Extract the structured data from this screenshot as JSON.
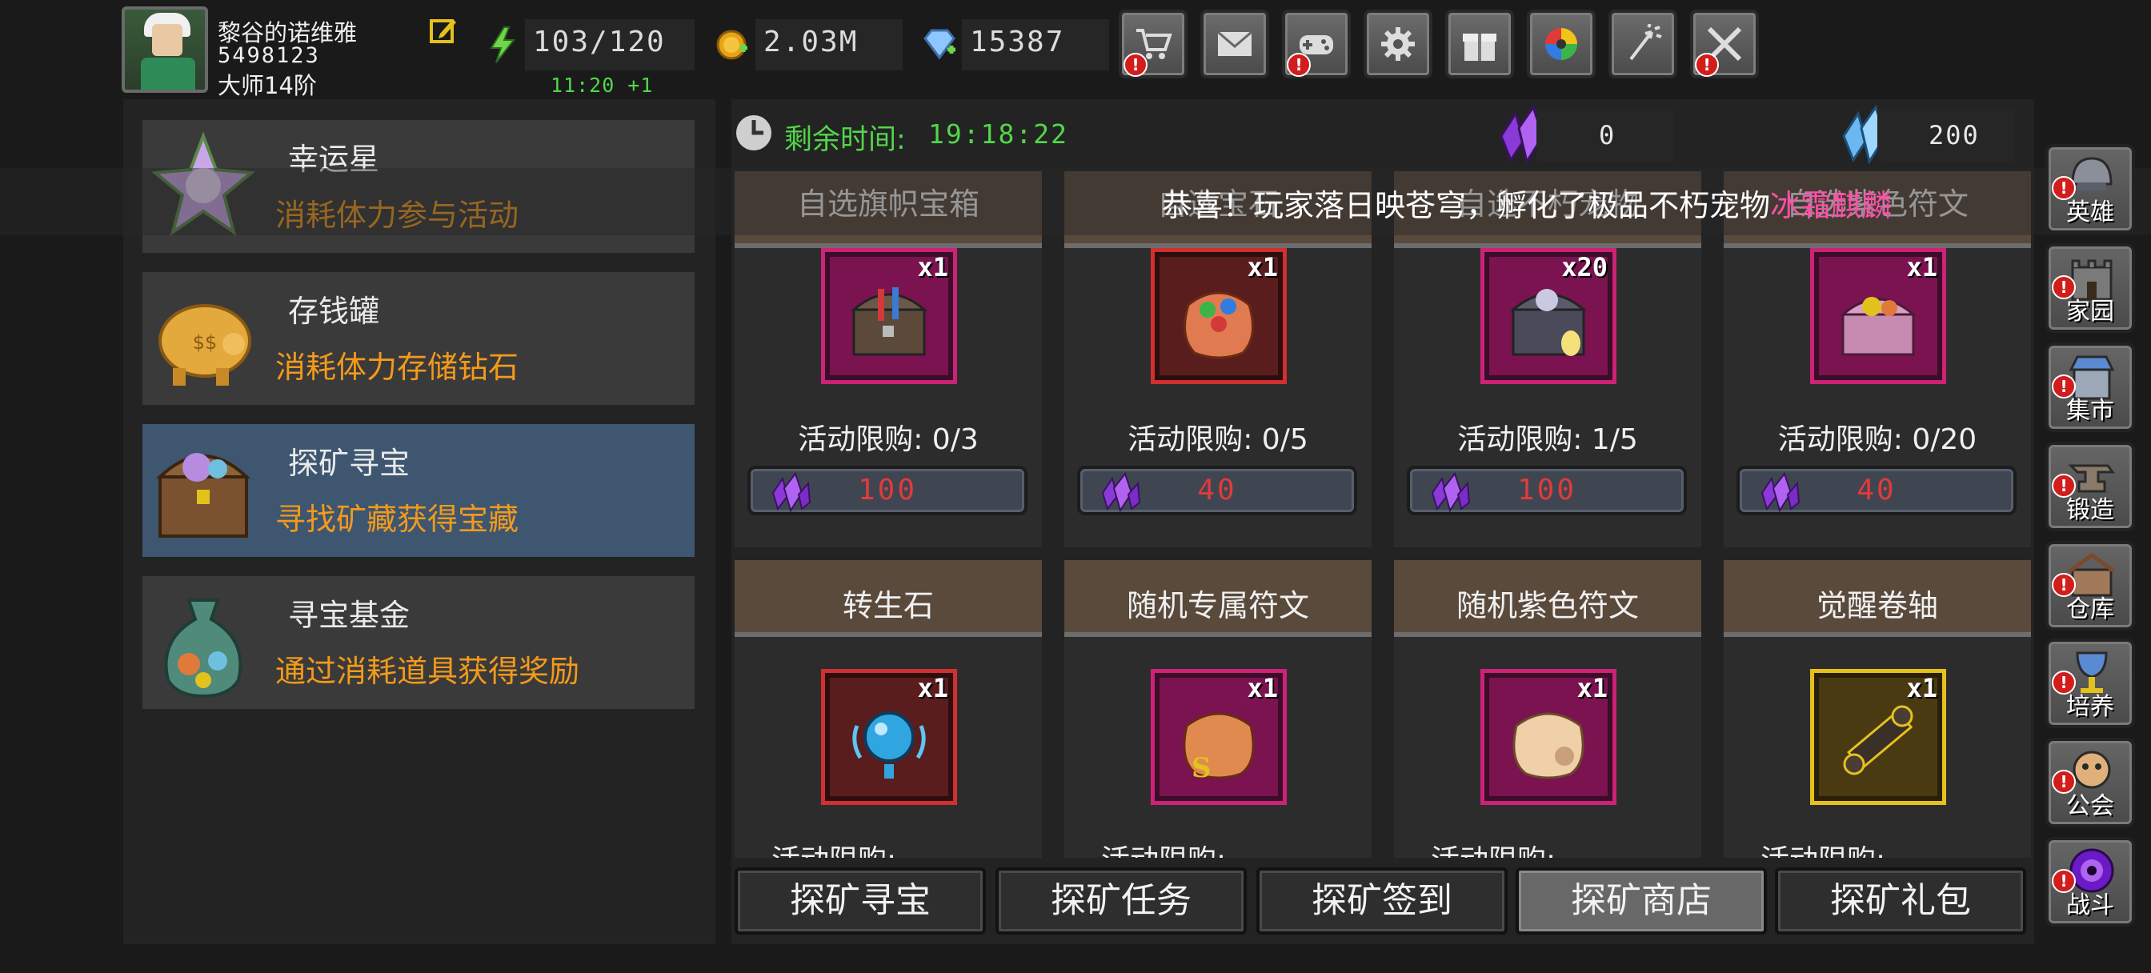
{
  "player": {
    "name": "黎谷的诺维雅",
    "id": "5498123",
    "rank": "大师14阶"
  },
  "resources": {
    "stamina": "103/120",
    "stamina_regen": "11:20 +1",
    "gold": "2.03M",
    "diamonds": "15387"
  },
  "top_buttons": [
    {
      "icon": "shop-cart-icon",
      "alert": true
    },
    {
      "icon": "mail-icon",
      "alert": false
    },
    {
      "icon": "gamepad-icon",
      "alert": true
    },
    {
      "icon": "settings-icon",
      "alert": false
    },
    {
      "icon": "gift-icon",
      "alert": false
    },
    {
      "icon": "color-wheel-icon",
      "alert": false
    },
    {
      "icon": "fireworks-icon",
      "alert": false
    },
    {
      "icon": "crossed-swords-icon",
      "alert": true
    }
  ],
  "menu": [
    {
      "title": "幸运星",
      "desc": "消耗体力参与活动"
    },
    {
      "title": "存钱罐",
      "desc": "消耗体力存储钻石"
    },
    {
      "title": "探矿寻宝",
      "desc": "寻找矿藏获得宝藏"
    },
    {
      "title": "寻宝基金",
      "desc": "通过消耗道具获得奖励"
    }
  ],
  "timer": {
    "label": "剩余时间:",
    "value": "19:18:22"
  },
  "currency": {
    "purple_crystal": "0",
    "blue_crystal": "200"
  },
  "broadcast": {
    "text": "恭喜！玩家落日映苍穹，孵化了极品不朽宠物",
    "highlight": "冰霜麒麟"
  },
  "shop_row1": [
    {
      "title": "自选旗帜宝箱",
      "qty": "x1",
      "limit": "活动限购: 0/3",
      "price": "100"
    },
    {
      "title": "自选宝石",
      "qty": "x1",
      "limit": "活动限购: 0/5",
      "price": "40"
    },
    {
      "title": "自选不朽宠物",
      "qty": "x20",
      "limit": "活动限购: 1/5",
      "price": "100"
    },
    {
      "title": "自选紫色符文",
      "qty": "x1",
      "limit": "活动限购: 0/20",
      "price": "40"
    }
  ],
  "shop_row2": [
    {
      "title": "转生石",
      "qty": "x1"
    },
    {
      "title": "随机专属符文",
      "qty": "x1"
    },
    {
      "title": "随机紫色符文",
      "qty": "x1"
    },
    {
      "title": "觉醒卷轴",
      "qty": "x1"
    }
  ],
  "row2_limit_partial": "活动限购:",
  "tabs": [
    "探矿寻宝",
    "探矿任务",
    "探矿签到",
    "探矿商店",
    "探矿礼包"
  ],
  "side_buttons": [
    {
      "label": "英雄",
      "icon": "helmet-icon"
    },
    {
      "label": "家园",
      "icon": "castle-icon"
    },
    {
      "label": "集市",
      "icon": "market-icon"
    },
    {
      "label": "锻造",
      "icon": "anvil-icon"
    },
    {
      "label": "仓库",
      "icon": "warehouse-icon"
    },
    {
      "label": "培养",
      "icon": "chalice-icon"
    },
    {
      "label": "公会",
      "icon": "guild-icon"
    },
    {
      "label": "战斗",
      "icon": "portal-icon"
    }
  ],
  "colors": {
    "accent_green": "#52d64a",
    "desc_orange": "#f39a1c",
    "price_red": "#e23a3a",
    "highlight_pink": "#ff4fa8",
    "active_menu": "#3e5670"
  }
}
